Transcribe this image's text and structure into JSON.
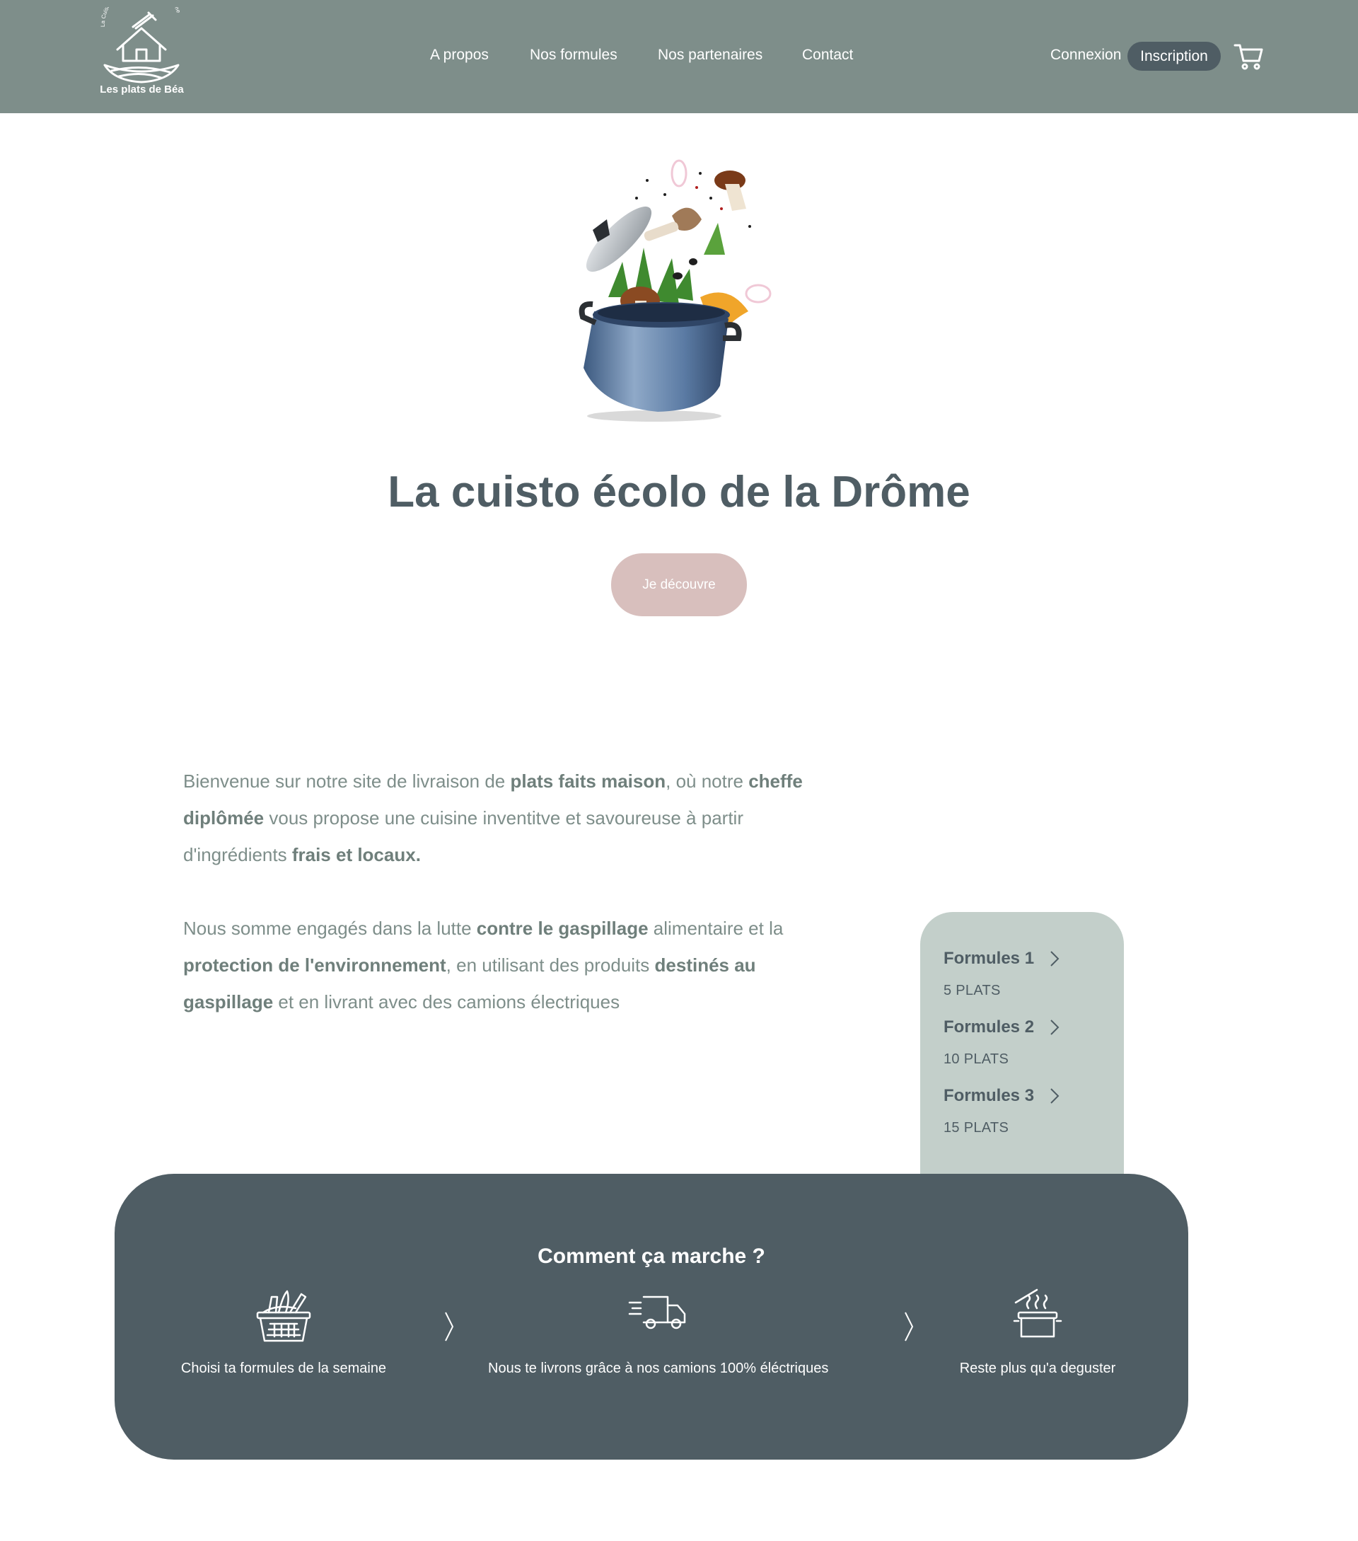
{
  "header": {
    "logo_text": "Les plats de Béa",
    "logo_arc_text": "La Cuisinière écoresponsable de la Drôme",
    "nav": [
      "A propos",
      "Nos formules",
      "Nos partenaires",
      "Contact"
    ],
    "login_label": "Connexion",
    "signup_label": "Inscription"
  },
  "hero": {
    "title": "La cuisto écolo de la Drôme",
    "cta_label": "Je découvre"
  },
  "intro": {
    "p1": [
      {
        "text": "Bienvenue sur notre site de livraison de ",
        "bold": false
      },
      {
        "text": "plats faits maison",
        "bold": true
      },
      {
        "text": ", où notre ",
        "bold": false
      },
      {
        "text": "cheffe diplômée",
        "bold": true
      },
      {
        "text": " vous propose une cuisine inventitve et savoureuse à partir d'ingrédients ",
        "bold": false
      },
      {
        "text": "frais et locaux.",
        "bold": true
      }
    ],
    "p2": [
      {
        "text": "Nous somme engagés dans la lutte ",
        "bold": false
      },
      {
        "text": "contre le gaspillage",
        "bold": true
      },
      {
        "text": " alimentaire et la ",
        "bold": false
      },
      {
        "text": "protection de l'environnement",
        "bold": true
      },
      {
        "text": ", en utilisant des produits ",
        "bold": false
      },
      {
        "text": "destinés au gaspillage",
        "bold": true
      },
      {
        "text": " et en livrant avec des camions électriques",
        "bold": false
      }
    ]
  },
  "formules": [
    {
      "title": "Formules 1",
      "subtitle": "5 PLATS"
    },
    {
      "title": "Formules 2",
      "subtitle": "10 PLATS"
    },
    {
      "title": "Formules 3",
      "subtitle": "15 PLATS"
    }
  ],
  "how": {
    "title": "Comment ça marche ?",
    "steps": [
      {
        "label": "Choisi ta formules de la semaine",
        "icon": "basket-icon"
      },
      {
        "label": "Nous te livrons grâce à nos camions 100% éléctriques",
        "icon": "delivery-truck-icon"
      },
      {
        "label": "Reste plus qu'a deguster",
        "icon": "cooking-pot-icon"
      }
    ]
  },
  "colors": {
    "header_bg": "#7e8e8a",
    "dark_slate": "#4f5d64",
    "cta_pink": "#d8bfbd",
    "card_sage": "#c3cfca"
  }
}
